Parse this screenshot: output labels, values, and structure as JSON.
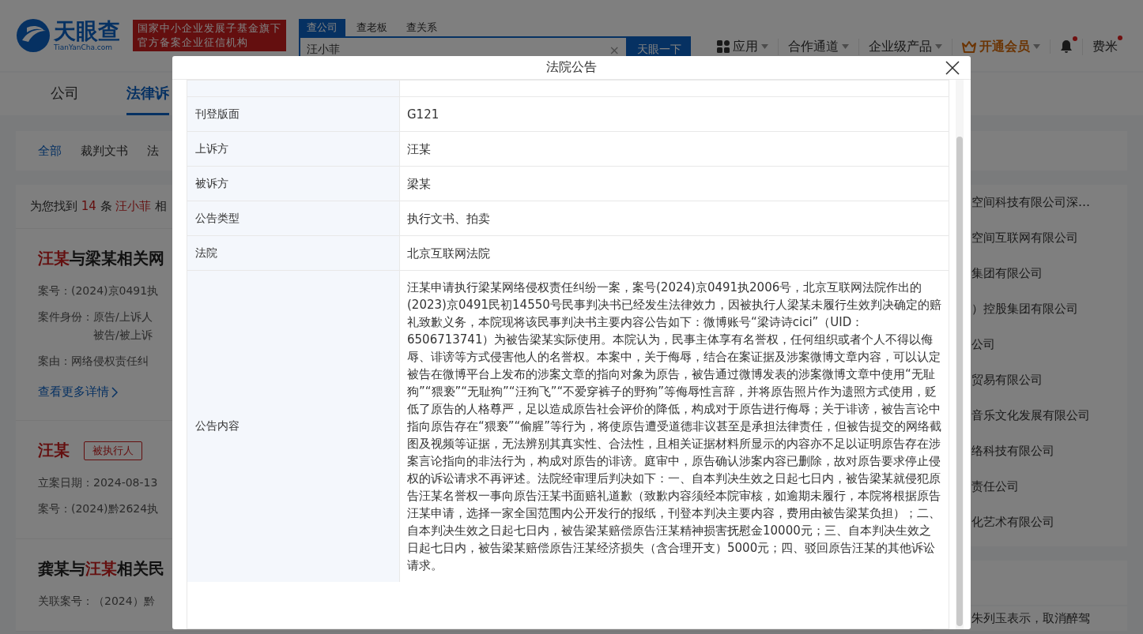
{
  "header": {
    "logo": {
      "name": "天眼查",
      "domain": "TianYanCha.com"
    },
    "badge_lines": [
      "国家中小企业发展子基金旗下",
      "官方备案企业征信机构"
    ],
    "search": {
      "tabs": [
        {
          "label": "查公司",
          "selected": true
        },
        {
          "label": "查老板",
          "selected": false
        },
        {
          "label": "查关系",
          "selected": false
        }
      ],
      "value": "汪小菲",
      "clear": "×",
      "button": "天眼一下"
    },
    "nav": [
      {
        "kind": "apps",
        "label": "应用",
        "dot": false
      },
      {
        "kind": "plain",
        "label": "合作通道",
        "dot": false
      },
      {
        "kind": "plain",
        "label": "企业级产品",
        "dot": false
      },
      {
        "kind": "vip",
        "label": "开通会员",
        "dot": false
      },
      {
        "kind": "bell",
        "dot": true
      },
      {
        "kind": "user",
        "label": "费米",
        "dot": true
      }
    ]
  },
  "page_tabs": [
    {
      "label": "公司",
      "selected": false
    },
    {
      "label": "法律诉",
      "selected": true
    }
  ],
  "filter_tabs": [
    {
      "label": "全部",
      "selected": true
    },
    {
      "label": "裁判文书",
      "selected": false
    },
    {
      "label": "法",
      "selected": false
    }
  ],
  "results_summary": [
    {
      "text": "为您找到 ",
      "highlight": false
    },
    {
      "text": "14",
      "highlight": true
    },
    {
      "text": " 条 ",
      "highlight": false
    },
    {
      "text": "汪小菲",
      "highlight": true
    },
    {
      "text": " 相",
      "highlight": false
    }
  ],
  "cards": [
    {
      "title": [
        {
          "text": "汪某",
          "highlight": true
        },
        {
          "text": "与梁某相关网",
          "highlight": false
        }
      ],
      "fields": [
        {
          "label": "案号：",
          "lines": [
            "(2024)京0491执"
          ]
        },
        {
          "label": "案件身份：",
          "lines": [
            "原告/上诉人",
            "被告/被上诉"
          ]
        },
        {
          "label": "案由：",
          "lines": [
            "网络侵权责任纠"
          ]
        }
      ],
      "link": "查看更多详情"
    },
    {
      "title": [
        {
          "text": "汪某",
          "highlight": true
        }
      ],
      "tag": "被执行人",
      "fields": [
        {
          "label": "立案日期：",
          "lines": [
            "2024-08-13"
          ]
        },
        {
          "label": "案号：",
          "lines": [
            "(2024)黔2624执"
          ]
        }
      ]
    },
    {
      "title": [
        {
          "text": "龚某与",
          "highlight": false
        },
        {
          "text": "汪某",
          "highlight": true
        },
        {
          "text": "相关民",
          "highlight": false
        }
      ],
      "fields": [
        {
          "label": "关联案号：",
          "lines": [
            "（2024）黔"
          ]
        }
      ]
    }
  ],
  "right_list": [
    "空间科技有限公司深…",
    "空间互联网有限公司",
    "集团有限公司",
    "）控股集团有限公司",
    "公司",
    "贸易有限公司",
    "音乐文化发展有限公司",
    "络科技有限公司",
    "责任公司",
    "化艺术有限公司"
  ],
  "right_bottom_text": "朱列玉表示，取消醉驾",
  "modal": {
    "title": "法院公告",
    "rows": [
      {
        "label": "刊登版面",
        "value": "G121"
      },
      {
        "label": "上诉方",
        "value": "汪某"
      },
      {
        "label": "被诉方",
        "value": "梁某"
      },
      {
        "label": "公告类型",
        "value": "执行文书、拍卖"
      },
      {
        "label": "法院",
        "value": "北京互联网法院"
      },
      {
        "label": "公告内容",
        "value": "汪某申请执行梁某网络侵权责任纠纷一案，案号(2024)京0491执2006号，北京互联网法院作出的(2023)京0491民初14550号民事判决书已经发生法律效力，因被执行人梁某未履行生效判决确定的赔礼致歉义务，本院现将该民事判决书主要内容公告如下：微博账号“梁诗诗cici”（UID：6506713741）为被告梁某实际使用。本院认为，民事主体享有名誉权，任何组织或者个人不得以侮辱、诽谤等方式侵害他人的名誉权。本案中，关于侮辱，结合在案证据及涉案微博文章内容，可以认定被告在微博平台上发布的涉案文章的指向对象为原告，被告通过微博发表的涉案微博文章中使用“无耻狗”“猥亵”“无耻狗”“汪狗飞”“不爱穿裤子的野狗”等侮辱性言辞，并将原告照片作为遗照方式使用，贬低了原告的人格尊严，足以造成原告社会评价的降低，构成对于原告进行侮辱；关于诽谤，被告言论中指向原告存在“猥亵”“偷腥”等行为，将使原告遭受道德非议甚至是承担法律责任，但被告提交的网络截图及视频等证据，无法辨别其真实性、合法性，且相关证据材料所显示的内容亦不足以证明原告存在涉案言论指向的非法行为，构成对原告的诽谤。庭审中，原告确认涉案内容已删除，故对原告要求停止侵权的诉讼请求不再评述。法院经审理后判决如下：一、自本判决生效之日起七日内，被告梁某就侵犯原告汪某名誉权一事向原告汪某书面赔礼道歉（致歉内容须经本院审核，如逾期未履行，本院将根据原告汪某申请，选择一家全国范围内公开发行的报纸，刊登本判决主要内容，费用由被告梁某负担）；二、自本判决生效之日起七日内，被告梁某赔偿原告汪某精神损害抚慰金10000元；三、自本判决生效之日起七日内，被告梁某赔偿原告汪某经济损失（含合理开支）5000元；四、驳回原告汪某的其他诉讼请求。"
      }
    ]
  }
}
